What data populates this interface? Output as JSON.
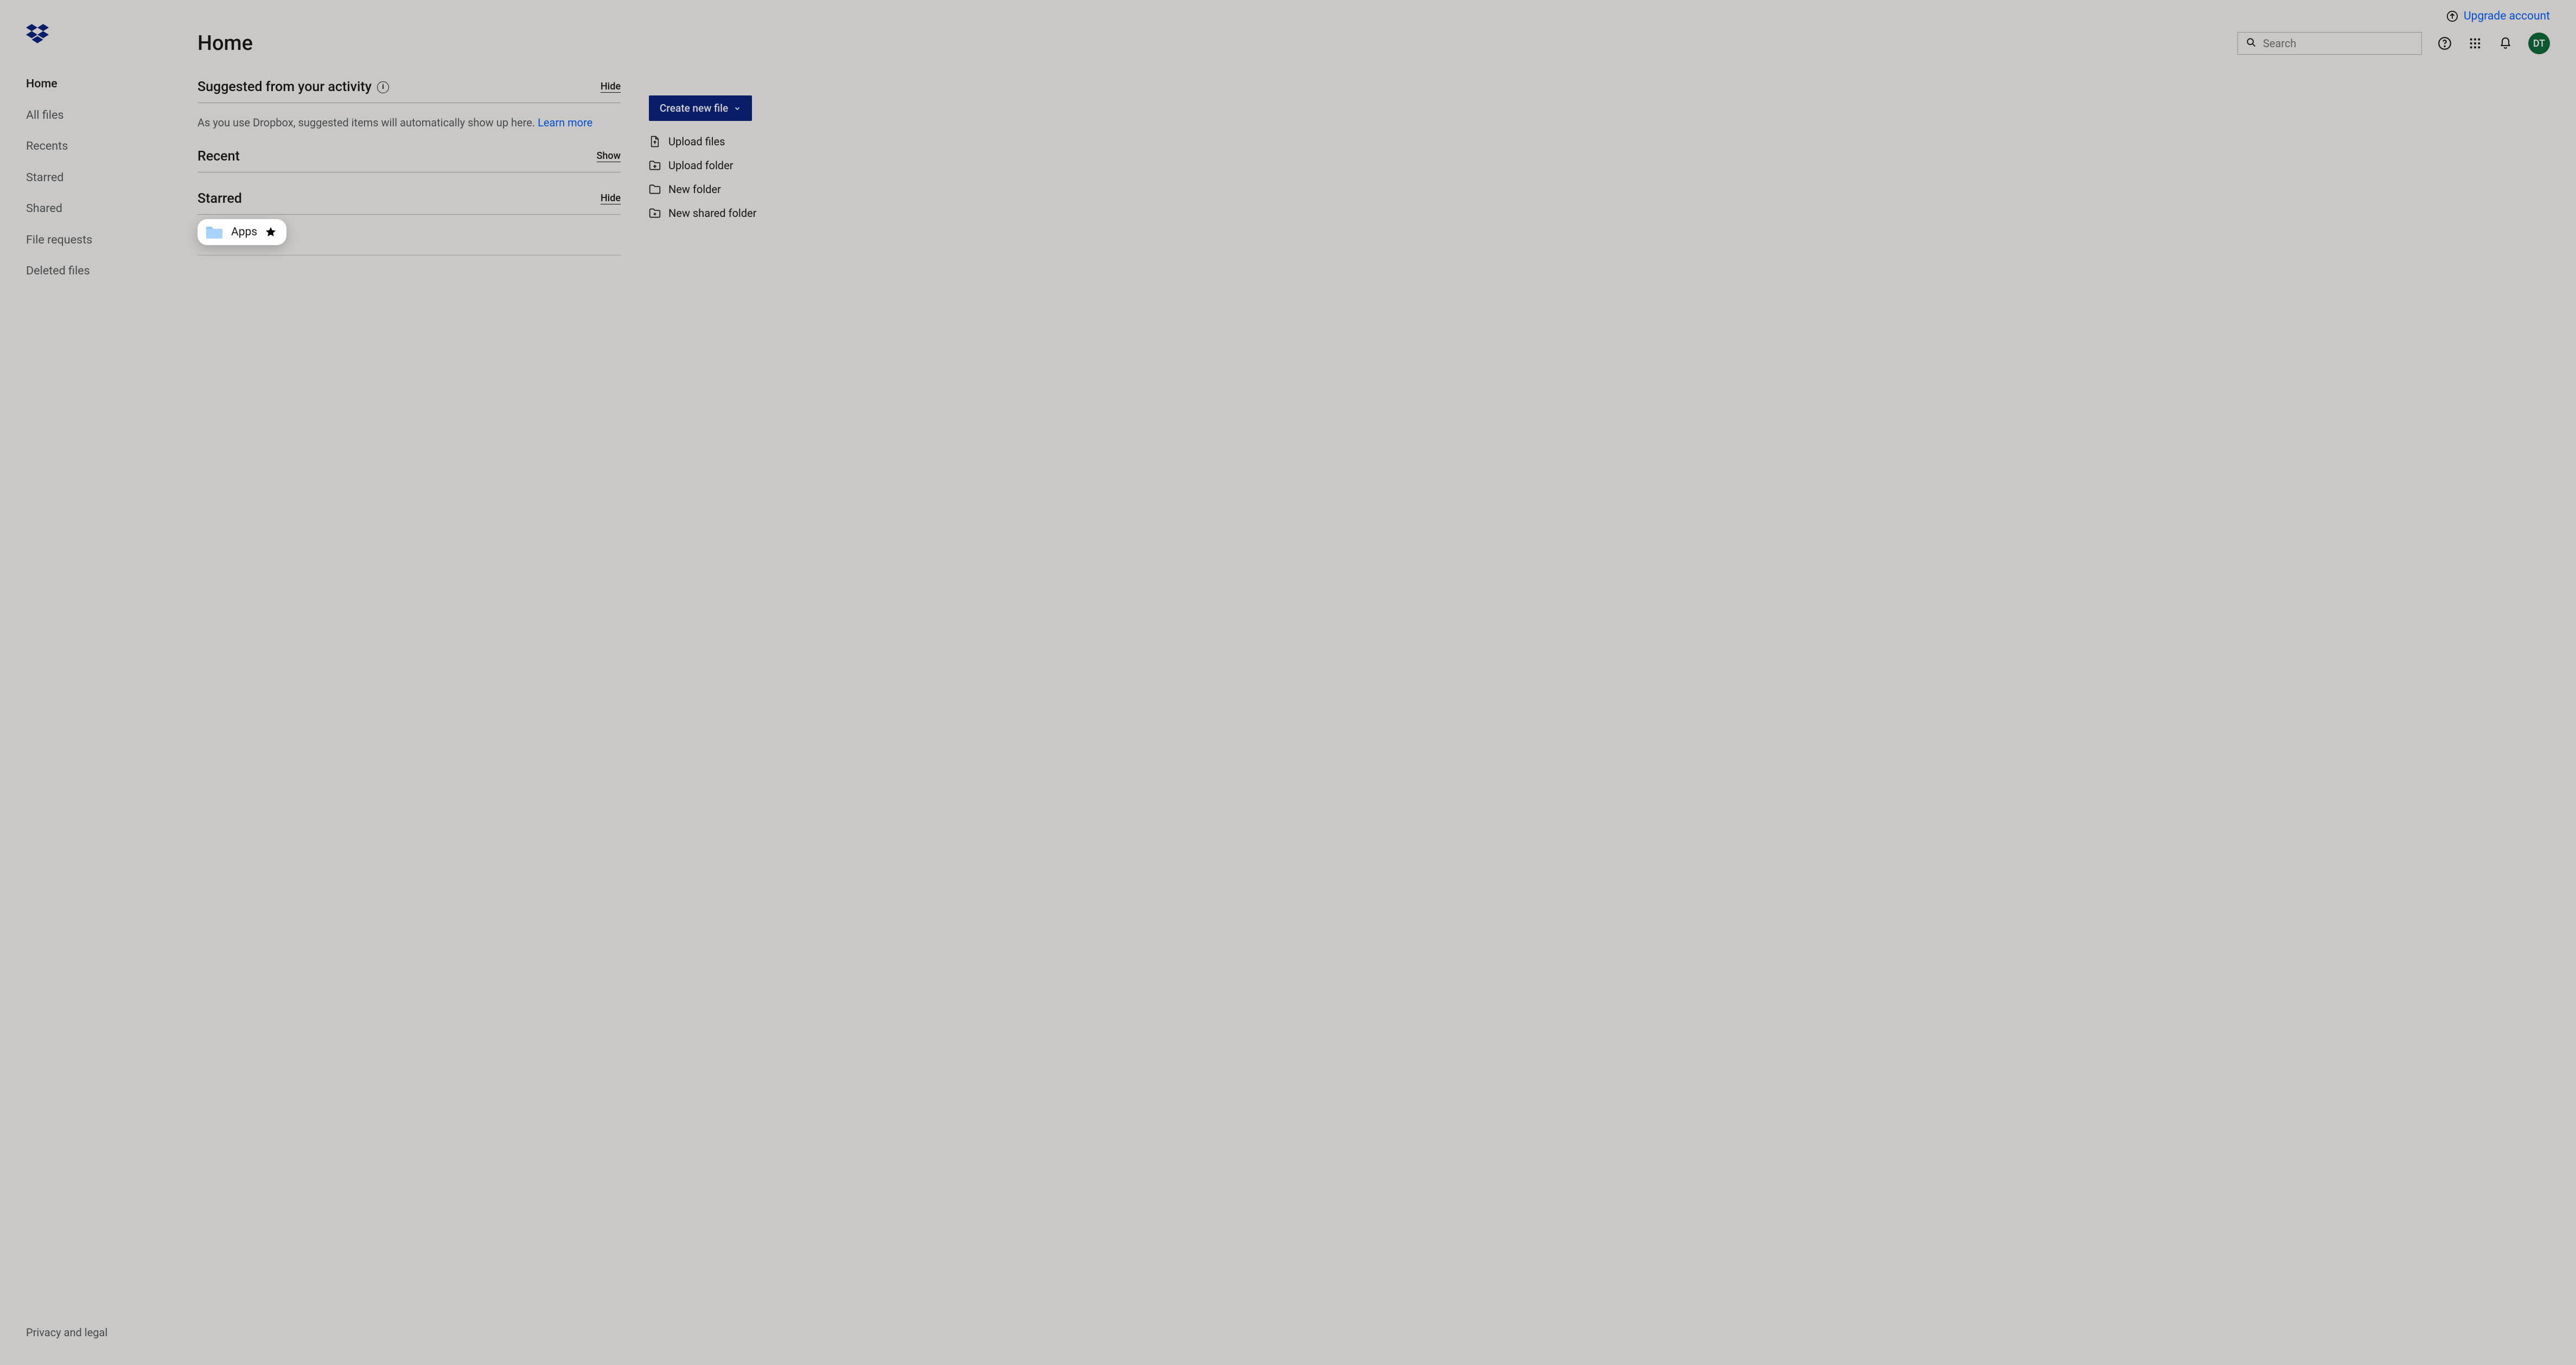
{
  "sidebar": {
    "items": [
      {
        "label": "Home",
        "active": true
      },
      {
        "label": "All files"
      },
      {
        "label": "Recents"
      },
      {
        "label": "Starred"
      },
      {
        "label": "Shared"
      },
      {
        "label": "File requests"
      },
      {
        "label": "Deleted files"
      }
    ],
    "footer": "Privacy and legal"
  },
  "header": {
    "upgrade": "Upgrade account",
    "title": "Home",
    "search_placeholder": "Search",
    "avatar_initials": "DT"
  },
  "suggested": {
    "title": "Suggested from your activity",
    "toggle": "Hide",
    "note": "As you use Dropbox, suggested items will automatically show up here. ",
    "note_link": "Learn more"
  },
  "recent": {
    "title": "Recent",
    "toggle": "Show"
  },
  "starred": {
    "title": "Starred",
    "toggle": "Hide",
    "items": [
      {
        "name": "Apps"
      }
    ]
  },
  "actions": {
    "primary": "Create new file",
    "list": [
      "Upload files",
      "Upload folder",
      "New folder",
      "New shared folder"
    ]
  }
}
